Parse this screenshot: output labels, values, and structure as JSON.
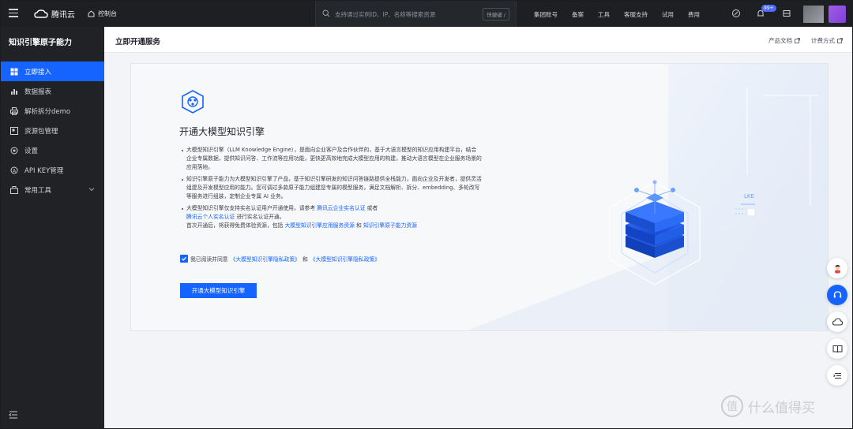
{
  "topbar": {
    "brand": "腾讯云",
    "console": "控制台",
    "search_placeholder": "支持通过实例ID、IP、名称等搜索资源",
    "shortcut": "快捷键 /",
    "nav": [
      "集团账号",
      "备案",
      "工具",
      "客服支持",
      "试用",
      "费用"
    ],
    "badge": "99+"
  },
  "sidebar": {
    "title": "知识引擎原子能力",
    "items": [
      {
        "label": "立即接入",
        "icon": "grid-icon",
        "active": true
      },
      {
        "label": "数据报表",
        "icon": "bar-chart-icon"
      },
      {
        "label": "解析拆分demo",
        "icon": "printer-icon"
      },
      {
        "label": "资源包管理",
        "icon": "package-icon"
      },
      {
        "label": "设置",
        "icon": "gear-icon"
      },
      {
        "label": "API KEY管理",
        "icon": "key-icon"
      },
      {
        "label": "常用工具",
        "icon": "toolbox-icon"
      }
    ]
  },
  "main": {
    "title": "立即开通服务",
    "links": [
      "产品文档",
      "计费方式"
    ]
  },
  "card": {
    "title": "开通大模型知识引擎",
    "bullet1": "大模型知识引擎（LLM Knowledge Engine），是面向企业客户及合作伙伴的，基于大语言模型的知识应用构建平台，结合企业专属数据，提供知识问答、工作流等应用功能，更快更高效地完成大模型应用的构建，推动大语言模型在企业服务场景的应用落地。",
    "bullet2": "知识引擎原子能力为大模型知识引擎了产品，基于知识引擎研发的知识问答链路提供全栈能力，面向企业及开发者，提供灵活组建及开发模型应用的能力。您可调过多款原子能力组建您专属的模型服务，满足文档解析、拆分、embedding、多轮改写等服务进行组装，定制企业专属 AI 业务。",
    "bullet3_pre": "大模型知识引擎仅支持实名认证用户开通使用，请参考",
    "bullet3_link1": "腾讯云企业实名认证",
    "bullet3_mid": "或者",
    "bullet3_link2": "腾讯云个人实名认证",
    "bullet3_post": "进行实名认证开通。",
    "bullet3_line3_pre": "首次开通后，将获得免费体验资源，包括",
    "bullet3_link3": "大模型知识引擎应用服务资源",
    "bullet3_and": "和",
    "bullet3_link4": "知识引擎原子能力资源",
    "agree_pre": "我已阅读并同意",
    "agree_link1": "《大模型知识引擎隐私政策》",
    "agree_and": "和",
    "agree_link2": "《大模型知识引擎隐私政策》",
    "button": "开通大模型知识引擎",
    "lke": "LKE"
  },
  "watermark": "什么值得买"
}
